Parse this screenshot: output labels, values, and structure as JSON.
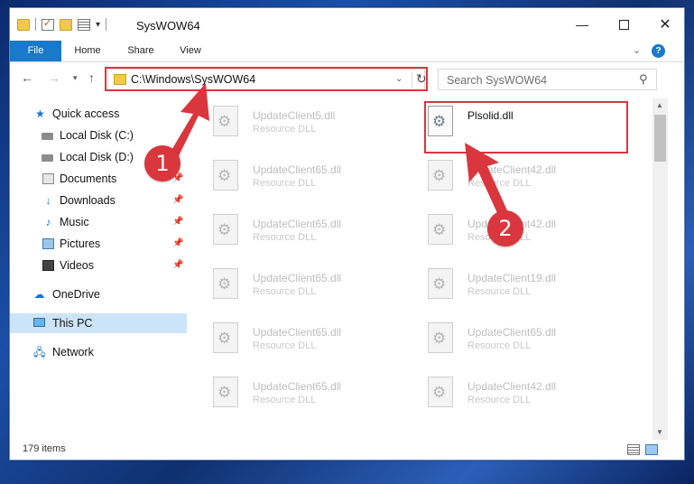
{
  "window": {
    "title": "SysWOW64",
    "qat_extra": "▾"
  },
  "ribbon": {
    "tabs": [
      "File",
      "Home",
      "Share",
      "View"
    ],
    "help": "?"
  },
  "nav": {
    "address": "C:\\Windows\\SysWOW64",
    "search_placeholder": "Search SysWOW64"
  },
  "sidebar": {
    "items": [
      {
        "label": "Quick access",
        "icon": "star-icon"
      },
      {
        "label": "Local Disk (C:)",
        "icon": "disk-icon"
      },
      {
        "label": "Local Disk (D:)",
        "icon": "disk-icon"
      },
      {
        "label": "Documents",
        "icon": "document-icon",
        "pinned": true
      },
      {
        "label": "Downloads",
        "icon": "download-icon",
        "pinned": true
      },
      {
        "label": "Music",
        "icon": "music-icon",
        "pinned": true
      },
      {
        "label": "Pictures",
        "icon": "pictures-icon",
        "pinned": true
      },
      {
        "label": "Videos",
        "icon": "video-icon",
        "pinned": true
      },
      {
        "label": "OneDrive",
        "icon": "cloud-icon"
      },
      {
        "label": "This PC",
        "icon": "computer-icon",
        "selected": true
      },
      {
        "label": "Network",
        "icon": "network-icon"
      }
    ]
  },
  "files": {
    "left": [
      {
        "name": "UpdateClient5.dll",
        "type": "Resource DLL"
      },
      {
        "name": "UpdateClient65.dll",
        "type": "Resource DLL"
      },
      {
        "name": "UpdateClient65.dll",
        "type": "Resource DLL"
      },
      {
        "name": "UpdateClient65.dll",
        "type": "Resource DLL"
      },
      {
        "name": "UpdateClient65.dll",
        "type": "Resource DLL"
      },
      {
        "name": "UpdateClient65.dll",
        "type": "Resource DLL"
      }
    ],
    "right": [
      {
        "name": "Plsolid.dll",
        "type": ""
      },
      {
        "name": "UpdateClient42.dll",
        "type": "Resource DLL"
      },
      {
        "name": "UpdateClient42.dll",
        "type": "Resource DLL"
      },
      {
        "name": "UpdateClient19.dll",
        "type": "Resource DLL"
      },
      {
        "name": "UpdateClient65.dll",
        "type": "Resource DLL"
      },
      {
        "name": "UpdateClient42.dll",
        "type": "Resource DLL"
      }
    ]
  },
  "status": {
    "count": "179 items"
  },
  "annotations": {
    "step1": "1",
    "step2": "2",
    "color": "#d9363e"
  }
}
